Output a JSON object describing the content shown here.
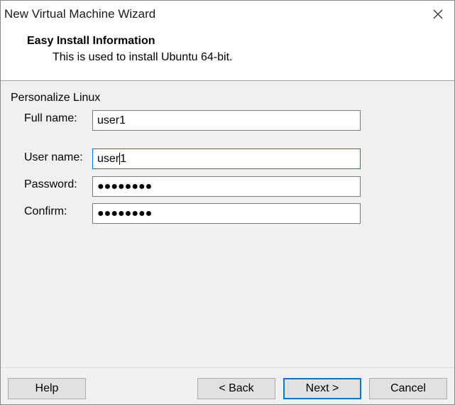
{
  "window": {
    "title": "New Virtual Machine Wizard"
  },
  "header": {
    "title": "Easy Install Information",
    "subtitle": "This is used to install Ubuntu 64-bit."
  },
  "section": {
    "label": "Personalize Linux"
  },
  "fields": {
    "full_name": {
      "label": "Full name:",
      "value": "user1"
    },
    "user_name": {
      "label": "User name:",
      "value_before_caret": "user",
      "value_after_caret": "1"
    },
    "password": {
      "label": "Password:",
      "masked": "●●●●●●●●"
    },
    "confirm": {
      "label": "Confirm:",
      "masked": "●●●●●●●●"
    }
  },
  "buttons": {
    "help": "Help",
    "back": "< Back",
    "next": "Next >",
    "cancel": "Cancel"
  },
  "colors": {
    "focus": "#0078d7",
    "button_bg": "#e1e1e1",
    "dialog_bg": "#f0f0f0"
  }
}
